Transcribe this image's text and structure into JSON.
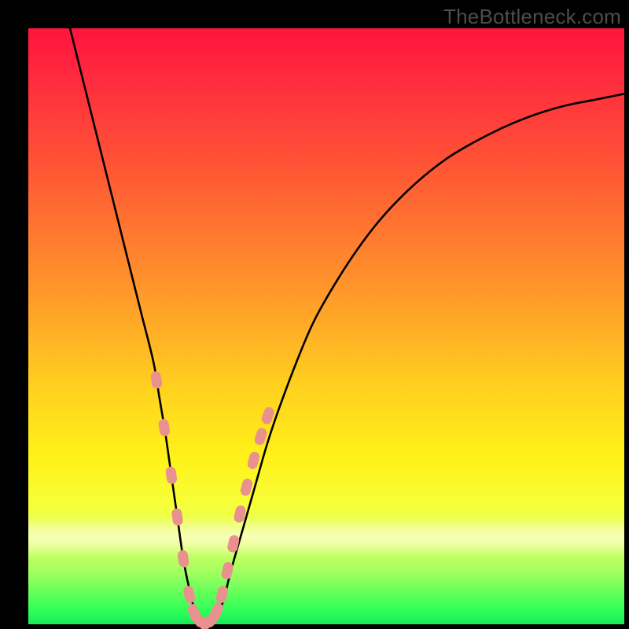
{
  "watermark": "TheBottleneck.com",
  "colors": {
    "frame": "#000000",
    "curve": "#000000",
    "bead": "#e9918f",
    "watermark": "#4d4d4d"
  },
  "chart_data": {
    "type": "line",
    "title": "",
    "xlabel": "",
    "ylabel": "",
    "xlim": [
      0,
      100
    ],
    "ylim": [
      0,
      100
    ],
    "x": [
      7,
      9,
      11,
      13,
      15,
      17,
      19,
      21,
      22,
      23,
      24,
      25,
      26,
      27,
      28,
      29,
      30,
      31,
      32,
      33,
      34,
      36,
      38,
      40,
      42,
      45,
      48,
      52,
      56,
      60,
      65,
      70,
      75,
      80,
      85,
      90,
      95,
      100
    ],
    "values": [
      100,
      92,
      84,
      76,
      68,
      60,
      52,
      44,
      38,
      32,
      25,
      18,
      11,
      6,
      2,
      0.5,
      0,
      0.5,
      2,
      5,
      9,
      16,
      23,
      30,
      36,
      44,
      51,
      58,
      64,
      69,
      74,
      78,
      81,
      83.5,
      85.5,
      87,
      88,
      89
    ],
    "beads_left_x": [
      21.5,
      22.8,
      24.0,
      25.0,
      26.0,
      27.0,
      27.8,
      28.5,
      29.2
    ],
    "beads_left_y": [
      41,
      33,
      25,
      18,
      11,
      5,
      2,
      0.8,
      0.3
    ],
    "beads_right_x": [
      30.0,
      30.8,
      31.6,
      32.5,
      33.4,
      34.4,
      35.5,
      36.6,
      37.8,
      39.0,
      40.2
    ],
    "beads_right_y": [
      0.3,
      0.8,
      2.2,
      5,
      9,
      13.5,
      18.5,
      23,
      27.5,
      31.5,
      35
    ]
  }
}
